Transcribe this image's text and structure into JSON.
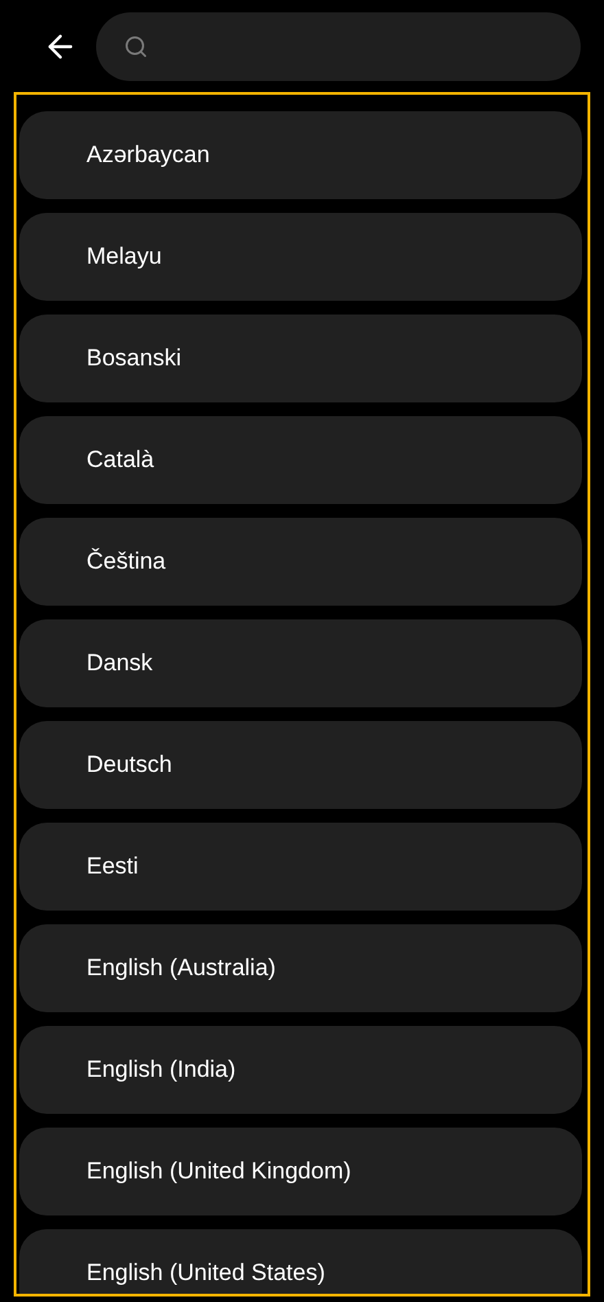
{
  "list": {
    "focused": true,
    "items": [
      {
        "label": "Azərbaycan"
      },
      {
        "label": "Melayu"
      },
      {
        "label": "Bosanski"
      },
      {
        "label": "Català"
      },
      {
        "label": "Čeština"
      },
      {
        "label": "Dansk"
      },
      {
        "label": "Deutsch"
      },
      {
        "label": "Eesti"
      },
      {
        "label": "English (Australia)"
      },
      {
        "label": "English (India)"
      },
      {
        "label": "English (United Kingdom)"
      },
      {
        "label": "English (United States)"
      }
    ]
  }
}
